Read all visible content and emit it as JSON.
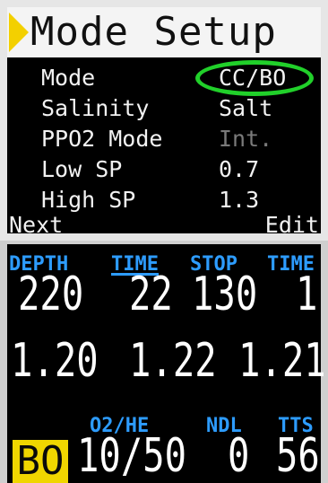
{
  "mode_setup": {
    "title": "Mode Setup",
    "rows": [
      {
        "label": "Mode",
        "value": "CC/BO",
        "highlighted": true
      },
      {
        "label": "Salinity",
        "value": "Salt"
      },
      {
        "label": "PPO2 Mode",
        "value": "Int.",
        "dimmed": true
      },
      {
        "label": "Low SP",
        "value": "0.7"
      },
      {
        "label": "High SP",
        "value": "1.3"
      }
    ],
    "softkeys": {
      "left": "Next",
      "right": "Edit"
    },
    "colors": {
      "title_bg": "#f4f4f4",
      "title_arrow": "#f3d000",
      "highlight": "#21d02a"
    }
  },
  "dive_screen": {
    "headers": {
      "depth": "DEPTH",
      "time": "TIME",
      "stop": "STOP",
      "stop_time": "TIME",
      "o2he": "O2/HE",
      "ndl": "NDL",
      "tts": "TTS"
    },
    "values": {
      "depth": "220",
      "time": "22",
      "stop": "130",
      "stop_time": "1",
      "ppo2_1": "1.20",
      "ppo2_2": "1.22",
      "ppo2_3": "1.21",
      "o2he": "10/50",
      "ndl": "0",
      "tts": "56"
    },
    "badge": "BO",
    "colors": {
      "header": "#2d9cff",
      "badge_bg": "#f0d600"
    }
  }
}
